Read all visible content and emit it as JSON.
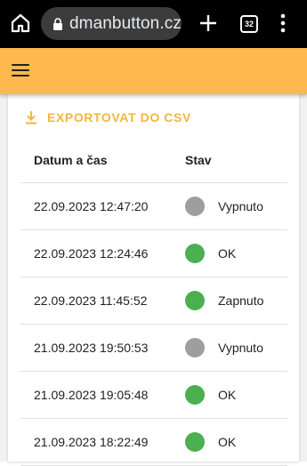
{
  "browser": {
    "url": "dmanbutton.cz",
    "tab_count": "32"
  },
  "export": {
    "label": "EXPORTOVAT DO CSV",
    "accent_color": "#f5b63a"
  },
  "app_bar": {
    "color": "#fdb94e"
  },
  "table": {
    "headers": {
      "datetime": "Datum a čas",
      "state": "Stav"
    },
    "rows": [
      {
        "datetime": "22.09.2023 12:47:20",
        "state": "Vypnuto",
        "status_color": "#9e9e9e"
      },
      {
        "datetime": "22.09.2023 12:24:46",
        "state": "OK",
        "status_color": "#4caf50"
      },
      {
        "datetime": "22.09.2023 11:45:52",
        "state": "Zapnuto",
        "status_color": "#4caf50"
      },
      {
        "datetime": "21.09.2023 19:50:53",
        "state": "Vypnuto",
        "status_color": "#9e9e9e"
      },
      {
        "datetime": "21.09.2023 19:05:48",
        "state": "OK",
        "status_color": "#4caf50"
      },
      {
        "datetime": "21.09.2023 18:22:49",
        "state": "OK",
        "status_color": "#4caf50"
      }
    ]
  }
}
